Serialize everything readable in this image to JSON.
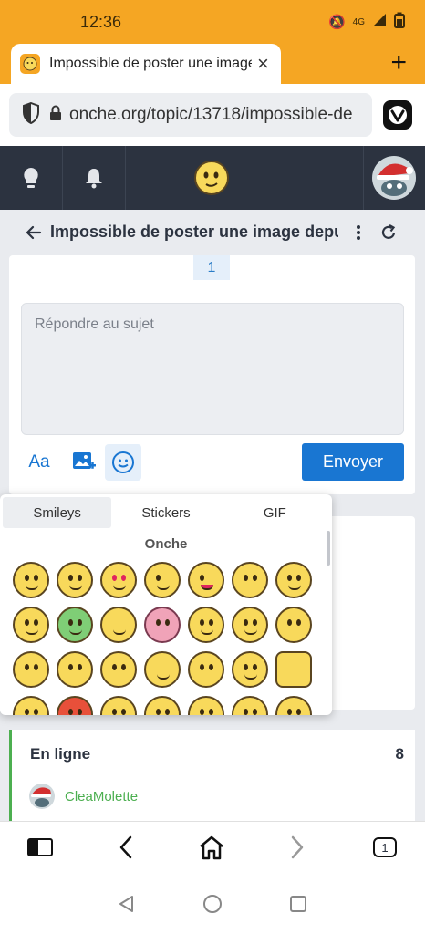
{
  "status": {
    "time": "12:36",
    "network": "4G"
  },
  "browser": {
    "tab_title": "Impossible de poster une image d",
    "url": "onche.org/topic/13718/impossible-de",
    "tab_count": "1"
  },
  "topic": {
    "title": "Impossible de poster une image depui",
    "page": "1"
  },
  "reply": {
    "placeholder": "Répondre au sujet",
    "font_button": "Aa",
    "send_label": "Envoyer"
  },
  "emoji_picker": {
    "tabs": [
      "Smileys",
      "Stickers",
      "GIF"
    ],
    "active_tab": "Smileys",
    "section": "Onche"
  },
  "online": {
    "title": "En ligne",
    "count": "8",
    "users": [
      "CleaMolette"
    ]
  },
  "colors": {
    "brand_orange": "#f5a623",
    "header_dark": "#2c3340",
    "primary_blue": "#1976d2",
    "online_green": "#4caf50"
  }
}
